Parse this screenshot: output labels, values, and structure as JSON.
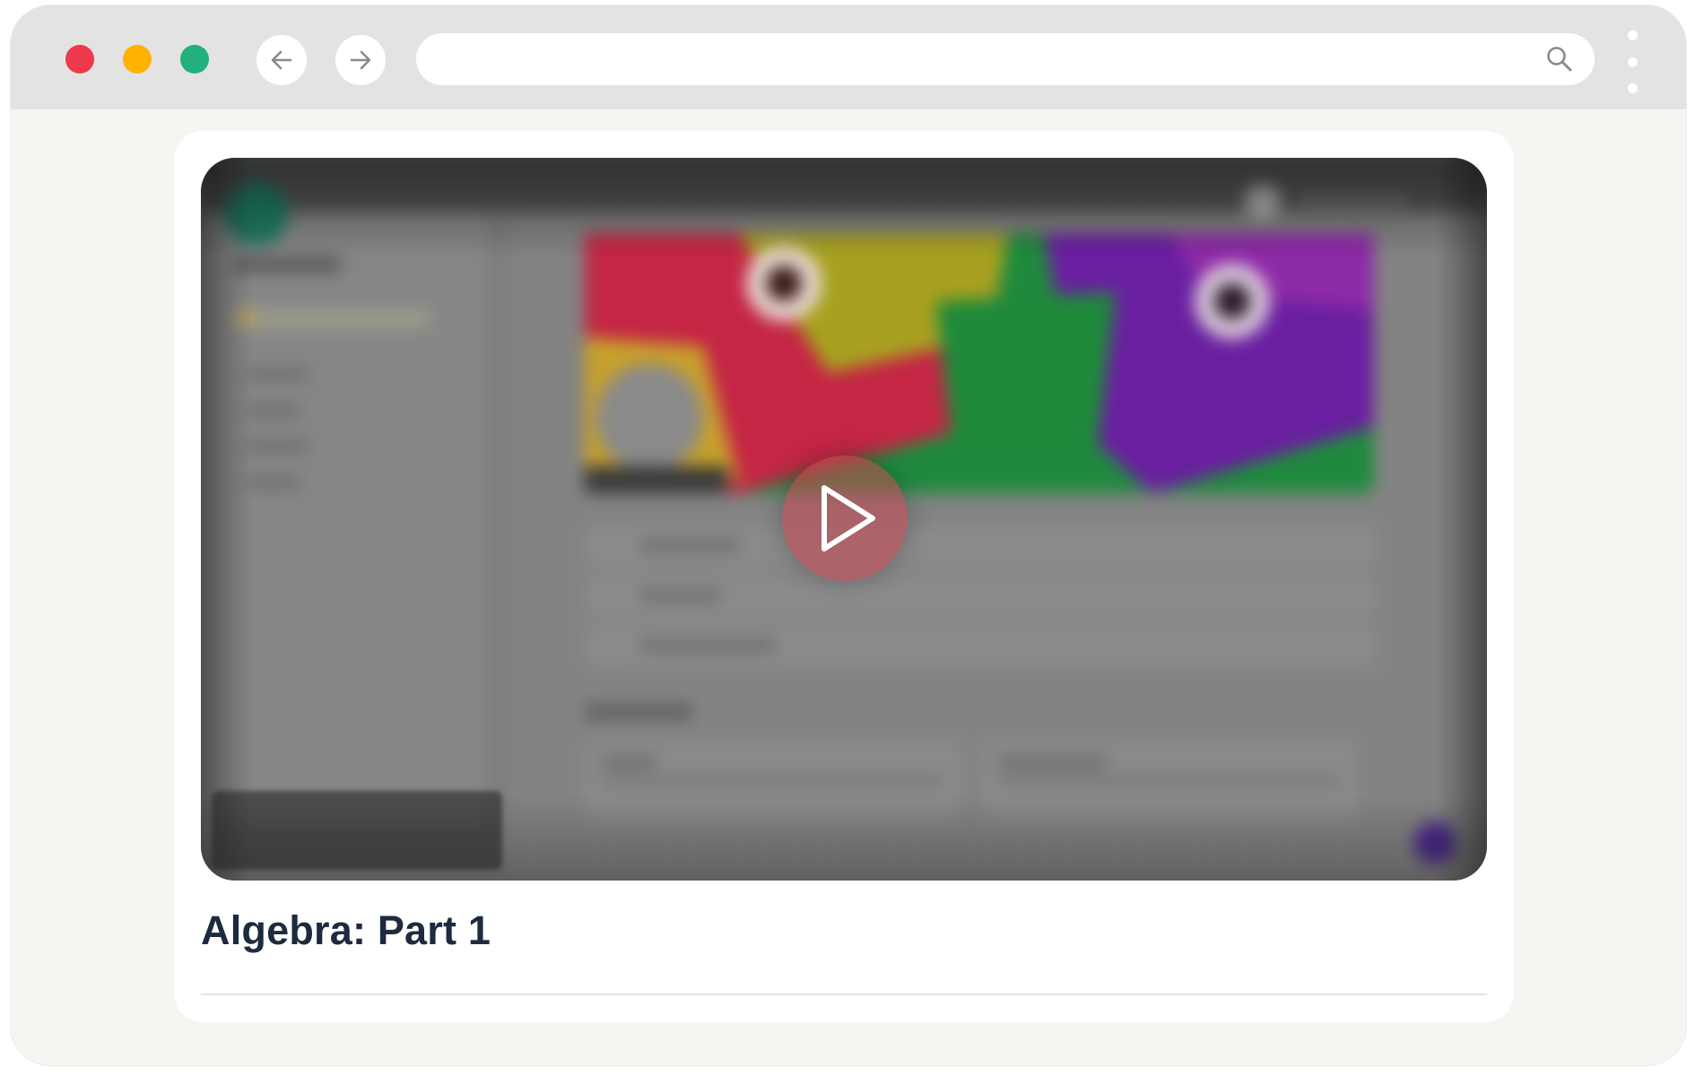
{
  "window": {
    "controls": [
      "close",
      "minimize",
      "maximize"
    ],
    "colors": {
      "close": "#ee3a4c",
      "minimize": "#ffb300",
      "maximize": "#22b07d"
    }
  },
  "toolbar": {
    "back_icon": "arrow-left-icon",
    "forward_icon": "arrow-right-icon",
    "menu_icon": "vertical-dots-icon"
  },
  "address_bar": {
    "value": "",
    "placeholder": "",
    "icon": "search-icon"
  },
  "video": {
    "title": "Algebra: Part 1",
    "play_icon": "play-icon",
    "blurred": true,
    "accent_color": "#d84a55"
  }
}
